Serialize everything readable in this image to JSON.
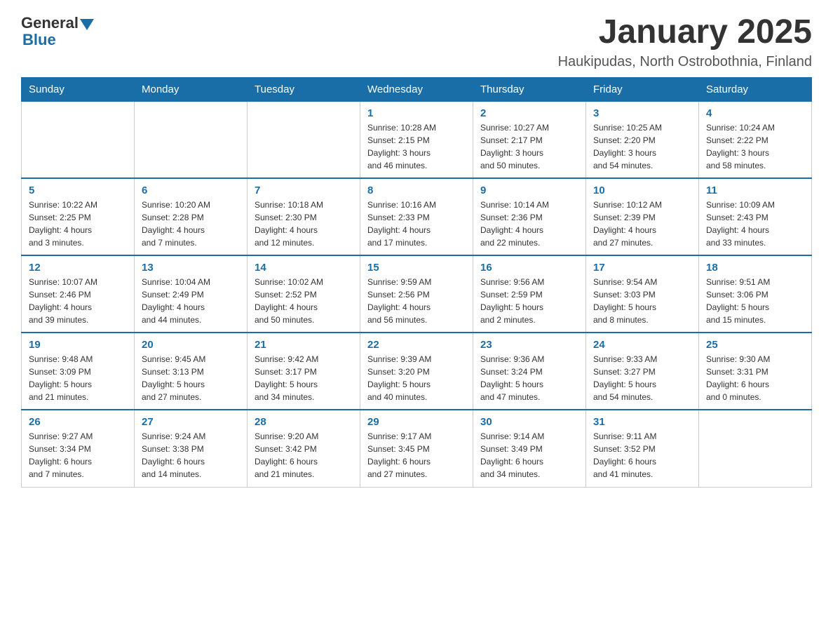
{
  "logo": {
    "general": "General",
    "blue": "Blue"
  },
  "header": {
    "title": "January 2025",
    "subtitle": "Haukipudas, North Ostrobothnia, Finland"
  },
  "weekdays": [
    "Sunday",
    "Monday",
    "Tuesday",
    "Wednesday",
    "Thursday",
    "Friday",
    "Saturday"
  ],
  "weeks": [
    [
      {
        "day": "",
        "info": ""
      },
      {
        "day": "",
        "info": ""
      },
      {
        "day": "",
        "info": ""
      },
      {
        "day": "1",
        "info": "Sunrise: 10:28 AM\nSunset: 2:15 PM\nDaylight: 3 hours\nand 46 minutes."
      },
      {
        "day": "2",
        "info": "Sunrise: 10:27 AM\nSunset: 2:17 PM\nDaylight: 3 hours\nand 50 minutes."
      },
      {
        "day": "3",
        "info": "Sunrise: 10:25 AM\nSunset: 2:20 PM\nDaylight: 3 hours\nand 54 minutes."
      },
      {
        "day": "4",
        "info": "Sunrise: 10:24 AM\nSunset: 2:22 PM\nDaylight: 3 hours\nand 58 minutes."
      }
    ],
    [
      {
        "day": "5",
        "info": "Sunrise: 10:22 AM\nSunset: 2:25 PM\nDaylight: 4 hours\nand 3 minutes."
      },
      {
        "day": "6",
        "info": "Sunrise: 10:20 AM\nSunset: 2:28 PM\nDaylight: 4 hours\nand 7 minutes."
      },
      {
        "day": "7",
        "info": "Sunrise: 10:18 AM\nSunset: 2:30 PM\nDaylight: 4 hours\nand 12 minutes."
      },
      {
        "day": "8",
        "info": "Sunrise: 10:16 AM\nSunset: 2:33 PM\nDaylight: 4 hours\nand 17 minutes."
      },
      {
        "day": "9",
        "info": "Sunrise: 10:14 AM\nSunset: 2:36 PM\nDaylight: 4 hours\nand 22 minutes."
      },
      {
        "day": "10",
        "info": "Sunrise: 10:12 AM\nSunset: 2:39 PM\nDaylight: 4 hours\nand 27 minutes."
      },
      {
        "day": "11",
        "info": "Sunrise: 10:09 AM\nSunset: 2:43 PM\nDaylight: 4 hours\nand 33 minutes."
      }
    ],
    [
      {
        "day": "12",
        "info": "Sunrise: 10:07 AM\nSunset: 2:46 PM\nDaylight: 4 hours\nand 39 minutes."
      },
      {
        "day": "13",
        "info": "Sunrise: 10:04 AM\nSunset: 2:49 PM\nDaylight: 4 hours\nand 44 minutes."
      },
      {
        "day": "14",
        "info": "Sunrise: 10:02 AM\nSunset: 2:52 PM\nDaylight: 4 hours\nand 50 minutes."
      },
      {
        "day": "15",
        "info": "Sunrise: 9:59 AM\nSunset: 2:56 PM\nDaylight: 4 hours\nand 56 minutes."
      },
      {
        "day": "16",
        "info": "Sunrise: 9:56 AM\nSunset: 2:59 PM\nDaylight: 5 hours\nand 2 minutes."
      },
      {
        "day": "17",
        "info": "Sunrise: 9:54 AM\nSunset: 3:03 PM\nDaylight: 5 hours\nand 8 minutes."
      },
      {
        "day": "18",
        "info": "Sunrise: 9:51 AM\nSunset: 3:06 PM\nDaylight: 5 hours\nand 15 minutes."
      }
    ],
    [
      {
        "day": "19",
        "info": "Sunrise: 9:48 AM\nSunset: 3:09 PM\nDaylight: 5 hours\nand 21 minutes."
      },
      {
        "day": "20",
        "info": "Sunrise: 9:45 AM\nSunset: 3:13 PM\nDaylight: 5 hours\nand 27 minutes."
      },
      {
        "day": "21",
        "info": "Sunrise: 9:42 AM\nSunset: 3:17 PM\nDaylight: 5 hours\nand 34 minutes."
      },
      {
        "day": "22",
        "info": "Sunrise: 9:39 AM\nSunset: 3:20 PM\nDaylight: 5 hours\nand 40 minutes."
      },
      {
        "day": "23",
        "info": "Sunrise: 9:36 AM\nSunset: 3:24 PM\nDaylight: 5 hours\nand 47 minutes."
      },
      {
        "day": "24",
        "info": "Sunrise: 9:33 AM\nSunset: 3:27 PM\nDaylight: 5 hours\nand 54 minutes."
      },
      {
        "day": "25",
        "info": "Sunrise: 9:30 AM\nSunset: 3:31 PM\nDaylight: 6 hours\nand 0 minutes."
      }
    ],
    [
      {
        "day": "26",
        "info": "Sunrise: 9:27 AM\nSunset: 3:34 PM\nDaylight: 6 hours\nand 7 minutes."
      },
      {
        "day": "27",
        "info": "Sunrise: 9:24 AM\nSunset: 3:38 PM\nDaylight: 6 hours\nand 14 minutes."
      },
      {
        "day": "28",
        "info": "Sunrise: 9:20 AM\nSunset: 3:42 PM\nDaylight: 6 hours\nand 21 minutes."
      },
      {
        "day": "29",
        "info": "Sunrise: 9:17 AM\nSunset: 3:45 PM\nDaylight: 6 hours\nand 27 minutes."
      },
      {
        "day": "30",
        "info": "Sunrise: 9:14 AM\nSunset: 3:49 PM\nDaylight: 6 hours\nand 34 minutes."
      },
      {
        "day": "31",
        "info": "Sunrise: 9:11 AM\nSunset: 3:52 PM\nDaylight: 6 hours\nand 41 minutes."
      },
      {
        "day": "",
        "info": ""
      }
    ]
  ]
}
